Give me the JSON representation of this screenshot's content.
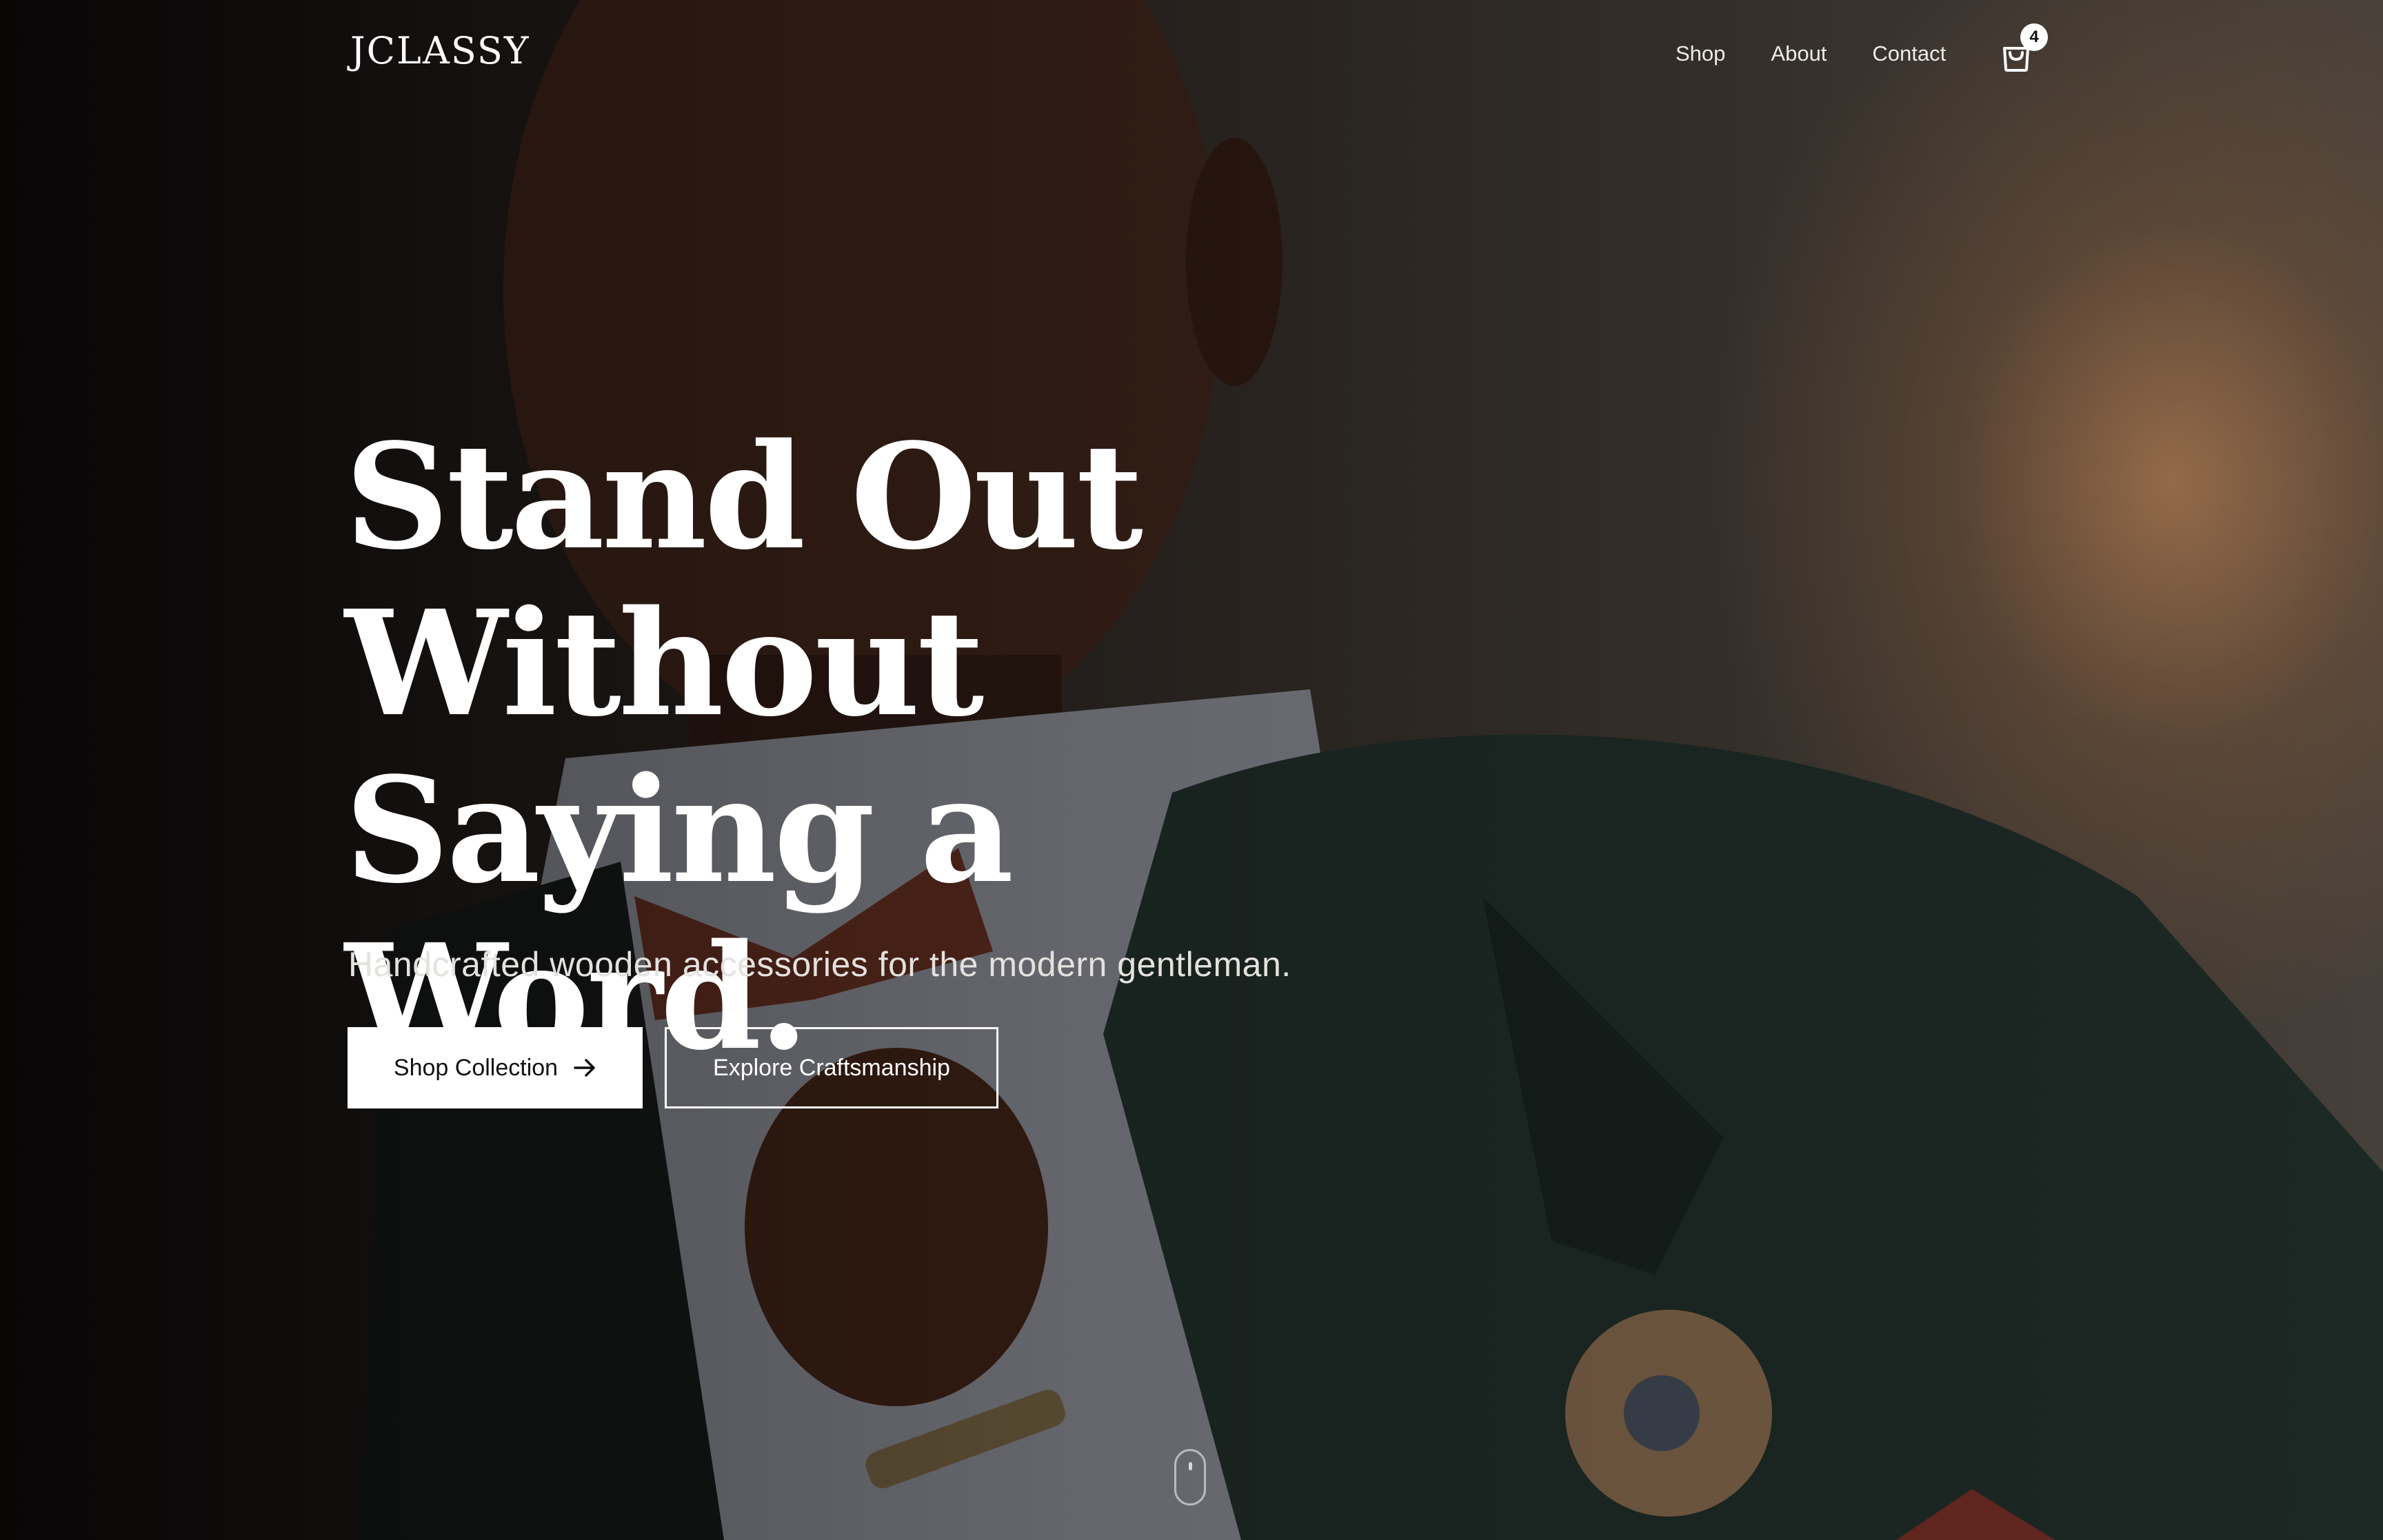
{
  "brand": {
    "logo_text": "JCLASSY"
  },
  "nav": {
    "links": [
      "Shop",
      "About",
      "Contact"
    ],
    "cart_count": "4"
  },
  "hero": {
    "headline_lines": [
      "Stand Out",
      "Without Saying a",
      "Word."
    ],
    "subtitle": "Handcrafted wooden accessories for the modern gentleman.",
    "primary_button": "Shop Collection",
    "secondary_button": "Explore Craftsmanship"
  },
  "icons": {
    "cart": "shopping-bag-icon",
    "arrow": "arrow-right-icon",
    "scroll": "mouse-scroll-icon"
  }
}
